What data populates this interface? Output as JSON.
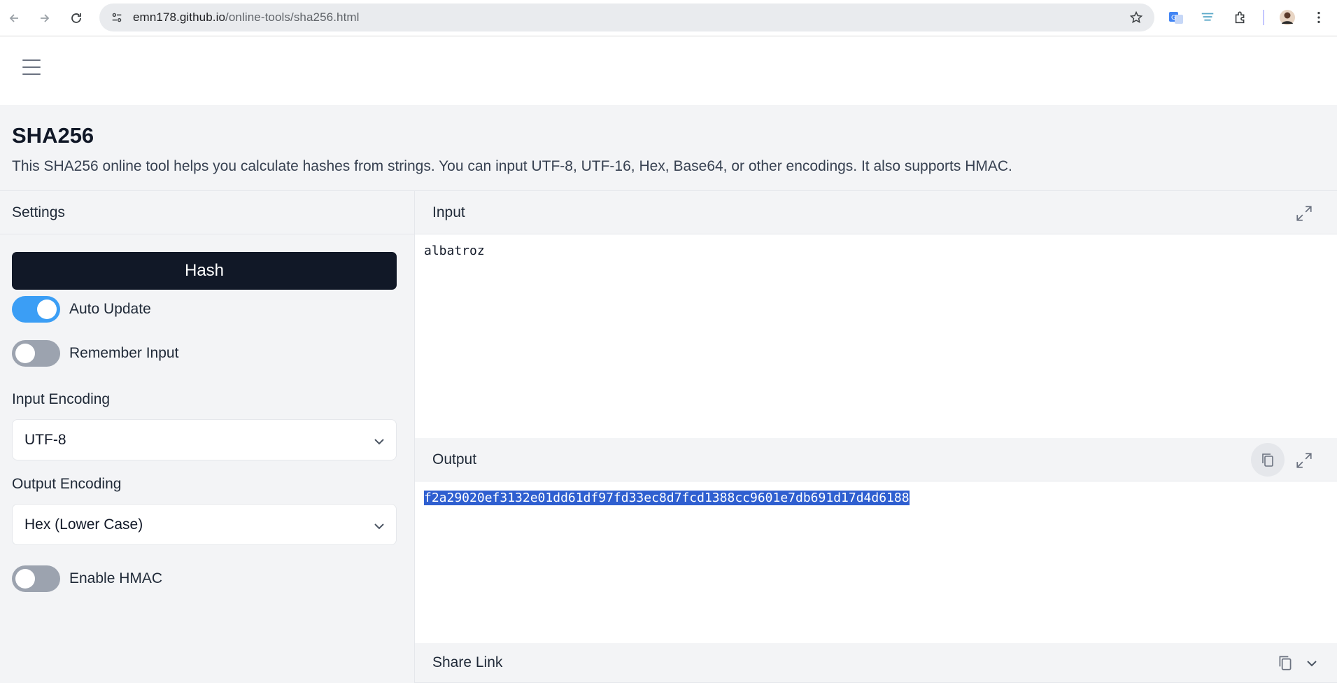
{
  "browser": {
    "url_host": "emn178.github.io",
    "url_path": "/online-tools/sha256.html"
  },
  "page": {
    "title": "SHA256",
    "description": "This SHA256 online tool helps you calculate hashes from strings. You can input UTF-8, UTF-16, Hex, Base64, or other encodings. It also supports HMAC."
  },
  "settings": {
    "header": "Settings",
    "hash_button": "Hash",
    "auto_update": {
      "label": "Auto Update",
      "on": true
    },
    "remember_input": {
      "label": "Remember Input",
      "on": false
    },
    "input_encoding": {
      "label": "Input Encoding",
      "value": "UTF-8"
    },
    "output_encoding": {
      "label": "Output Encoding",
      "value": "Hex (Lower Case)"
    },
    "enable_hmac": {
      "label": "Enable HMAC",
      "on": false
    }
  },
  "input": {
    "header": "Input",
    "value": "albatroz"
  },
  "output": {
    "header": "Output",
    "value": "f2a29020ef3132e01dd61df97fd33ec8d7fcd1388cc9601e7db691d17d4d6188"
  },
  "share": {
    "header": "Share Link"
  },
  "colors": {
    "toggle_on": "#3b9ef5",
    "toggle_off": "#9ca3af",
    "hash_button_bg": "#111827",
    "selection": "#2f5fd0"
  }
}
